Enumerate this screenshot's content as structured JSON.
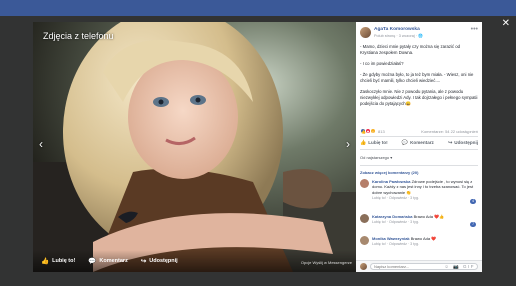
{
  "window": {
    "close_glyph": "✕"
  },
  "photo": {
    "title": "Zdjęcia z telefonu",
    "nav_prev_glyph": "‹",
    "nav_next_glyph": "›",
    "actions": [
      {
        "label": "Lubię to!",
        "icon": "like-icon",
        "glyph": "👍"
      },
      {
        "label": "Komentarz",
        "icon": "comment-icon",
        "glyph": "💬"
      },
      {
        "label": "Udostępnij",
        "icon": "share-icon",
        "glyph": "↪"
      }
    ],
    "meta": "Opcje    Wyślij w Messengerze"
  },
  "post": {
    "author": "AgaTa Komorowska",
    "subline": "Polub stronę · 3 wczoraj · 🌐",
    "menu_glyph": "•••",
    "paragraphs": [
      "- Mamo, dzieci mnie pytały czy można się zarazić od Krystiana zespołem Downa.",
      "- I co im powiedziałaś?",
      "- Że gdyby można było, to ja też bym miała. - Wiesz, oni nie chcieli być mamili, tylko chcieli wiedzieć....",
      "Zaskoczyło mnie. Nie z powodu pytania, ale z powodu niezwykłej odpowiedzi Ady. I tak dojrzałego i pełnego sympatii podejścia do pytających😄"
    ],
    "reactions": {
      "count": "813",
      "icons": [
        "like-icon",
        "love-icon",
        "wow-icon"
      ]
    },
    "comment_stats": "Komentarze: 54   22 udostępnień",
    "actions": [
      {
        "label": "Lubię to!",
        "icon": "like-icon",
        "glyph": "👍"
      },
      {
        "label": "Komentarz",
        "icon": "comment-icon",
        "glyph": "💬"
      },
      {
        "label": "Udostępnij",
        "icon": "share-icon",
        "glyph": "↪"
      }
    ],
    "sort": "Od najstarszego ▾",
    "more_comments": "Zobacz więcej komentarzy (20)",
    "comments": [
      {
        "name": "Karolina Pawłowska",
        "text": "Zdrowe podejście , to wynosi się z domu. Każdy z nas jest inny i to trzeba szanować. To jest dobre wychowanie 👏",
        "actions": "Lubię to! · Odpowiedz · 3 tyg.",
        "reaction": "4",
        "avatar_color": "#b57f6a"
      },
      {
        "name": "Katarzyna Domańska",
        "text": "Brawo Ada ❤️👍",
        "actions": "Lubię to! · Odpowiedz · 3 tyg.",
        "reaction": "7",
        "avatar_color": "#8a6f5a"
      },
      {
        "name": "Monika Wawrzyniak",
        "text": "Brawo Ada ❤️",
        "actions": "Lubię to! · Odpowiedz · 3 tyg.",
        "reaction": "",
        "avatar_color": "#a7896f"
      }
    ],
    "write_placeholder": "Napisz komentarz...",
    "write_icons": "☺ 📷 GIF"
  }
}
